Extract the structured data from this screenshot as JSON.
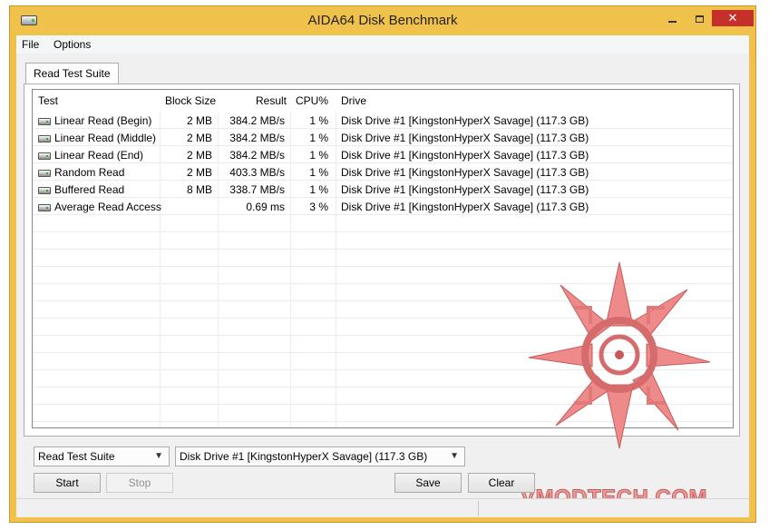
{
  "window": {
    "title": "AIDA64 Disk Benchmark"
  },
  "menu": {
    "file": "File",
    "options": "Options"
  },
  "tab": {
    "label": "Read Test Suite"
  },
  "table": {
    "headers": {
      "test": "Test",
      "block": "Block Size",
      "result": "Result",
      "cpu": "CPU%",
      "drive": "Drive"
    },
    "rows": [
      {
        "test": "Linear Read (Begin)",
        "block": "2 MB",
        "result": "384.2 MB/s",
        "cpu": "1 %",
        "drive": "Disk Drive #1  [KingstonHyperX Savage]  (117.3 GB)"
      },
      {
        "test": "Linear Read (Middle)",
        "block": "2 MB",
        "result": "384.2 MB/s",
        "cpu": "1 %",
        "drive": "Disk Drive #1  [KingstonHyperX Savage]  (117.3 GB)"
      },
      {
        "test": "Linear Read (End)",
        "block": "2 MB",
        "result": "384.2 MB/s",
        "cpu": "1 %",
        "drive": "Disk Drive #1  [KingstonHyperX Savage]  (117.3 GB)"
      },
      {
        "test": "Random Read",
        "block": "2 MB",
        "result": "403.3 MB/s",
        "cpu": "1 %",
        "drive": "Disk Drive #1  [KingstonHyperX Savage]  (117.3 GB)"
      },
      {
        "test": "Buffered Read",
        "block": "8 MB",
        "result": "338.7 MB/s",
        "cpu": "1 %",
        "drive": "Disk Drive #1  [KingstonHyperX Savage]  (117.3 GB)"
      },
      {
        "test": "Average Read Access",
        "block": "",
        "result": "0.69 ms",
        "cpu": "3 %",
        "drive": "Disk Drive #1  [KingstonHyperX Savage]  (117.3 GB)"
      }
    ]
  },
  "controls": {
    "suite_select": "Read Test Suite",
    "drive_select": "Disk Drive #1  [KingstonHyperX Savage]  (117.3 GB)",
    "start": "Start",
    "stop": "Stop",
    "save": "Save",
    "clear": "Clear"
  },
  "watermark": {
    "text": "VMODTECH.COM"
  },
  "icons": {
    "app": "disk-icon",
    "row": "disk-icon",
    "minimize": "minimize-icon",
    "maximize": "maximize-icon",
    "close": "close-icon",
    "dropdown": "chevron-down-icon"
  },
  "colors": {
    "title_bar": "#f0c24c",
    "close_button": "#c7302a",
    "watermark": "#f19a9a"
  }
}
